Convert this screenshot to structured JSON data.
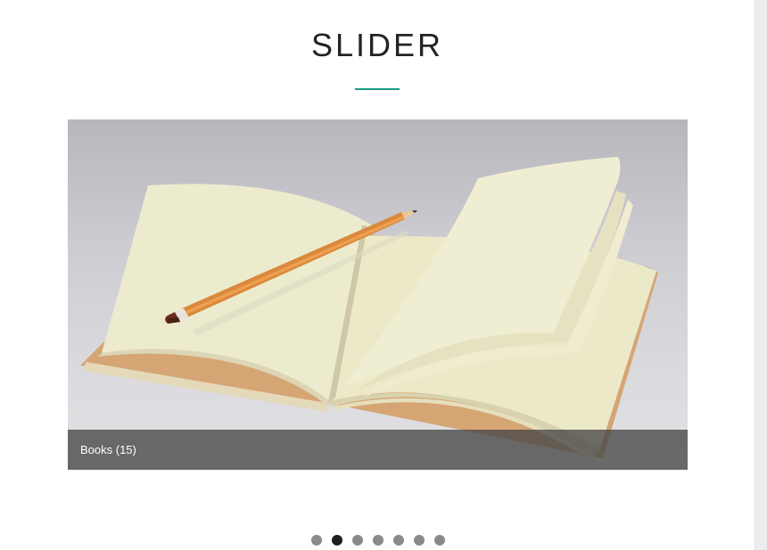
{
  "section": {
    "title": "SLIDER",
    "accent_color": "#1a9b82"
  },
  "slider": {
    "current_index": 1,
    "slide_count": 7,
    "slide": {
      "image": "open-notebook-with-pencil",
      "caption": "Books (15)"
    }
  },
  "pagination": {
    "active_color": "#1f1f1f",
    "inactive_color": "#8a8a8a"
  }
}
